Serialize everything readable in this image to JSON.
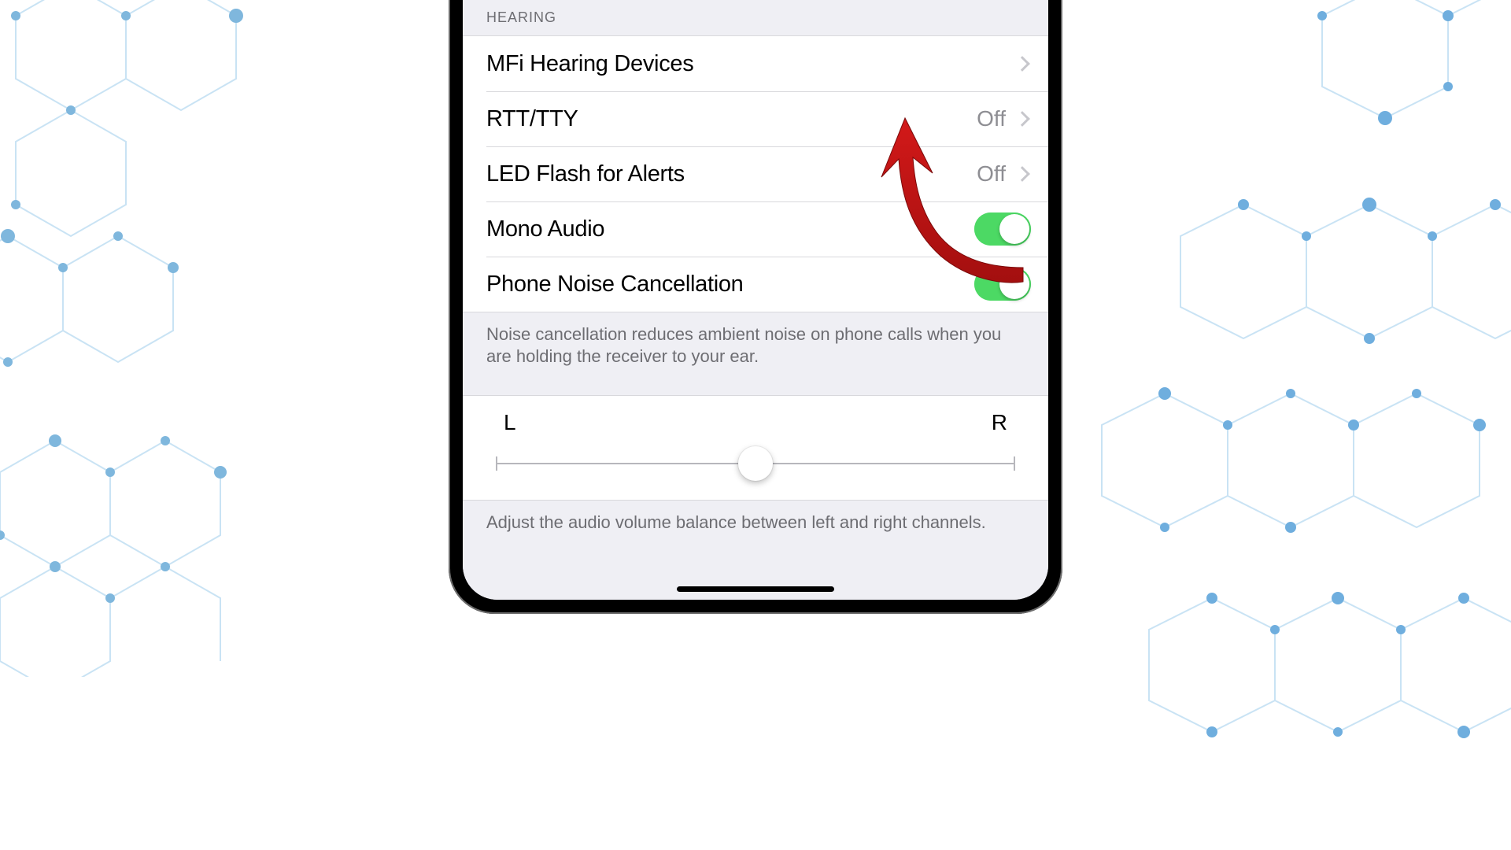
{
  "section_header": "HEARING",
  "rows": {
    "mfi": {
      "label": "MFi Hearing Devices"
    },
    "rtt": {
      "label": "RTT/TTY",
      "value": "Off"
    },
    "led": {
      "label": "LED Flash for Alerts",
      "value": "Off"
    },
    "mono": {
      "label": "Mono Audio"
    },
    "noise": {
      "label": "Phone Noise Cancellation"
    }
  },
  "noise_footer": "Noise cancellation reduces ambient noise on phone calls when you are holding the receiver to your ear.",
  "balance": {
    "left": "L",
    "right": "R"
  },
  "balance_footer": "Adjust the audio volume balance between left and right channels."
}
